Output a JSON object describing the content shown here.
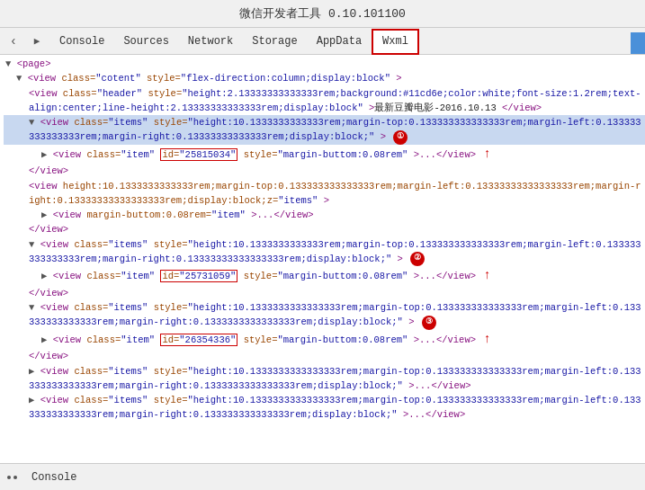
{
  "titleBar": {
    "text": "微信开发者工具 0.10.101100"
  },
  "tabs": [
    {
      "id": "console",
      "label": "Console",
      "active": false
    },
    {
      "id": "sources",
      "label": "Sources",
      "active": false
    },
    {
      "id": "network",
      "label": "Network",
      "active": false
    },
    {
      "id": "storage",
      "label": "Storage",
      "active": false
    },
    {
      "id": "appdata",
      "label": "AppData",
      "active": false
    },
    {
      "id": "wxml",
      "label": "Wxml",
      "active": true,
      "highlighted": true
    }
  ],
  "codeLines": [
    {
      "id": 1,
      "indent": 0,
      "content": "▼ <page>"
    },
    {
      "id": 2,
      "indent": 1,
      "content": "▼ <view class=\"cotent\" style=\"flex-direction:column;display:block\">"
    },
    {
      "id": 3,
      "indent": 2,
      "content": "  <view class=\"header\" style=\"height:2.13333333333333rem;background:#11cd6e;color:white;font-size:1.2rem;text-align:center;line-height:2.13333333333333rem;display:block\">最新豆瓣电影- 2016.10.13 </view>"
    },
    {
      "id": 4,
      "indent": 2,
      "content": "  ▼ <view class=\"items\" style=\"height:10.1333333333333rem;margin-top:0.133333333333333rem;margin-left:0.133333333333333rem;margin-right:0.13333333333333rem;display:block;\">",
      "annotation": "1",
      "selected": true
    },
    {
      "id": 5,
      "indent": 3,
      "content": "    ▶ <view class=\"item\" id=\"25815034\" style=\"margin-buttom:0.08rem\">...</view>",
      "hasRedBox": true,
      "boxId": "25815034"
    },
    {
      "id": 6,
      "indent": 2,
      "content": "  </view>"
    },
    {
      "id": 7,
      "indent": 2,
      "content": "  <view height:10.1333333333333rem;margin-top:0.133333333333333rem;margin-left:0.13333333333333333rem;margin-right:0.13333333333333333rem;display:block;z=\"items\">"
    },
    {
      "id": 8,
      "indent": 3,
      "content": "    ▶ <view margin-buttom:0.08rem=\"item\">...</view>"
    },
    {
      "id": 9,
      "indent": 2,
      "content": "  </view>"
    },
    {
      "id": 10,
      "indent": 2,
      "content": "  ▼ <view class=\"items\" style=\"height:10.1333333333333rem;margin-top:0.133333333333333rem;margin-left:0.133333333333333rem;margin-right:0.13333333333333333rem;display:block;\">",
      "annotation": "2"
    },
    {
      "id": 11,
      "indent": 3,
      "content": "    ▶ <view class=\"item\" id=\"25731059\" style=\"margin-buttom:0.08rem\">...</view>",
      "hasRedBox": true,
      "boxId": "25731059"
    },
    {
      "id": 12,
      "indent": 2,
      "content": "  </view>"
    },
    {
      "id": 13,
      "indent": 2,
      "content": "  ▼ <view class=\"items\" style=\"height:10.1333333333333333rem;margin-top:0.133333333333333rem;margin-left:0.133333333333333rem;margin-right:0.1333333333333333rem;display:block;\">",
      "annotation": "3"
    },
    {
      "id": 14,
      "indent": 3,
      "content": "    ▶ <view class=\"item\" id=\"26354336\" style=\"margin-buttom:0.08rem\">...</view>",
      "hasRedBox": true,
      "boxId": "26354336"
    },
    {
      "id": 15,
      "indent": 2,
      "content": "  </view>"
    },
    {
      "id": 16,
      "indent": 2,
      "content": "  ▶ <view class=\"items\" style=\"height:10.1333333333333333rem;margin-top:0.133333333333333rem;margin-left:0.133333333333333rem;margin-right:0.1333333333333333rem;display:block;\">...</view>"
    },
    {
      "id": 17,
      "indent": 2,
      "content": "  ▶ <view class=\"items\" style=\"height:10.1333333333333333rem;margin-top:0.133333333333333rem;margin-left:0.133333333333333rem;margin-right:0.133333333333333rem;display:block;\">...</view>"
    }
  ],
  "bottomBar": {
    "consoleLabel": "Console"
  },
  "annotations": {
    "arrow1Label": "↑",
    "circle1": "①",
    "circle2": "②",
    "circle3": "③"
  }
}
